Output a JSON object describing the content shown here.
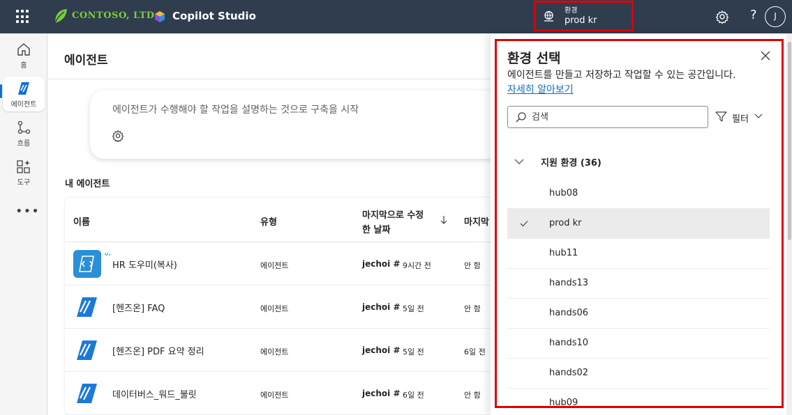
{
  "topbar": {
    "company": "CONTOSO, LTD.",
    "app_name": "Copilot Studio",
    "environment_label": "환경",
    "environment_value": "prod kr",
    "avatar_initial": "J",
    "help": "?"
  },
  "rail": {
    "items": [
      {
        "label": "홈",
        "icon": "home-icon"
      },
      {
        "label": "에이전트",
        "icon": "agents-icon"
      },
      {
        "label": "흐름",
        "icon": "flows-icon"
      },
      {
        "label": "도구",
        "icon": "tools-icon"
      }
    ],
    "more": "•••"
  },
  "main": {
    "title": "에이전트",
    "prompt_placeholder": "에이전트가 수행해야 할 작업을 설명하는 것으로 구축을 시작",
    "section_title": "내 에이전트",
    "columns": {
      "name": "이름",
      "type": "유형",
      "modified_line1": "마지막으로 수정",
      "modified_line2": "한 날짜",
      "last": "마지막"
    },
    "rows": [
      {
        "name": "HR 도우미(복사)",
        "type": "에이전트",
        "user": "jechoi #",
        "time": "9시간 전",
        "last": "안 함"
      },
      {
        "name": "[헨즈온] FAQ",
        "type": "에이전트",
        "user": "jechoi #",
        "time": "5일 전",
        "last": "안 함"
      },
      {
        "name": "[헨즈온] PDF 요약 정리",
        "type": "에이전트",
        "user": "jechoi #",
        "time": "5일 전",
        "last": "6일 전"
      },
      {
        "name": "데이터버스_워드_불릿",
        "type": "에이전트",
        "user": "jechoi #",
        "time": "6일 전",
        "last": "안 함"
      }
    ]
  },
  "panel": {
    "title": "환경 선택",
    "description": "에이전트를 만들고 저장하고 작업할 수 있는 공간입니다.",
    "learn_more": "자세히 알아보기",
    "search_placeholder": "검색",
    "filter_label": "필터",
    "group_label": "지원 환경 (36)",
    "environments": [
      {
        "name": "hub08",
        "selected": false
      },
      {
        "name": "prod kr",
        "selected": true
      },
      {
        "name": "hub11",
        "selected": false
      },
      {
        "name": "hands13",
        "selected": false
      },
      {
        "name": "hands06",
        "selected": false
      },
      {
        "name": "hands10",
        "selected": false
      },
      {
        "name": "hands02",
        "selected": false
      },
      {
        "name": "hub09",
        "selected": false
      }
    ]
  },
  "colors": {
    "topbar": "#2f3d4f",
    "accent": "#0f6cbd",
    "highlight_box": "#e00000",
    "brand_green": "#7ccc3a"
  }
}
